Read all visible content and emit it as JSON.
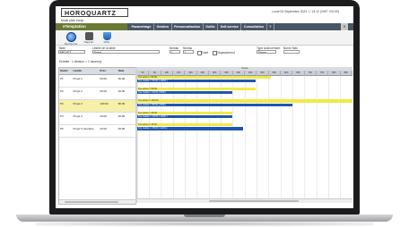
{
  "app": {
    "logo": "HOROQUARTZ",
    "datetime": "Lundi 04 Septembre 2023 ⓘ 13:12 (GMT +02:00)",
    "mode": "Mode plein écran",
    "module": "eTemptation",
    "nav": [
      "Paramétrage",
      "Gestion",
      "Personnalisation",
      "Outils",
      "Self-service",
      "Consultation",
      "?"
    ],
    "close": "✕"
  },
  "toolbar": [
    {
      "label": "Recherche",
      "icon": "search-icon"
    },
    {
      "label": "Rapport",
      "icon": "report-icon"
    },
    {
      "label": "Filtre",
      "icon": "filter-icon"
    }
  ],
  "filters": {
    "table_label": "Table",
    "table_value": "PROJET",
    "libelle_label": "Libellé de la table",
    "libelle_value": "Projet",
    "niveau_label": "Niveau",
    "niveau_value": "1",
    "niveau2_label": "Niveau",
    "niveau2_value": "1",
    "ecart_label": "Ecart",
    "depassement_label": "Dépassement",
    "type_label": "Type Avancement",
    "type_value": "Temps",
    "borne_label": "Borne Max"
  },
  "scale": "Echelle : 1 division = 1 heure(s)",
  "left_grid": {
    "headers": [
      "Statut",
      "Libellé",
      "Prév.",
      "Réal."
    ],
    "rows": [
      {
        "statut": "P1",
        "lib": "Projet 1",
        "prev": "50:00",
        "real": "50:00",
        "sel": false
      },
      {
        "statut": "P2",
        "lib": "Projet 2",
        "prev": "50:00",
        "real": "40:00",
        "sel": false
      },
      {
        "statut": "P3",
        "lib": "Projet 3",
        "prev": "100:00",
        "real": "80:00",
        "sel": true
      },
      {
        "statut": "P4",
        "lib": "Projet 4",
        "prev": "40:00",
        "real": "40:00",
        "sel": false
      },
      {
        "statut": "P5",
        "lib": "Projet 5 (Sociéte)",
        "prev": "40:00",
        "real": "45:00",
        "sel": false
      }
    ]
  },
  "gantt": {
    "title": "Durée",
    "columns": [
      "0h",
      "5h",
      "10h",
      "15h",
      "20h",
      "25h",
      "30h",
      "35h",
      "40h",
      "45h",
      "50h",
      "55h",
      "60h",
      "65h",
      "70h",
      "75h",
      "80h",
      "85h"
    ],
    "bars": [
      {
        "prev_label": "Tps prévu = 50:00",
        "prev_frac": 0.62,
        "real_label": "Tps réalisé = 50:00 ( 100% )",
        "real_frac": 0.55
      },
      {
        "prev_label": "Tps prévu = 50:00",
        "prev_frac": 0.55,
        "real_label": "Tps réalisé = 40:00 ( 80% )",
        "real_frac": 0.44
      },
      {
        "prev_label": "Tps prévu = 100:00",
        "prev_frac": 1.0,
        "real_label": "Tps réalisé = 80:00 ( 80% )",
        "real_frac": 0.72
      },
      {
        "prev_label": "Tps prévu = 40:00",
        "prev_frac": 0.44,
        "real_label": "Tps réalisé = 40:00 ( 100% )",
        "real_frac": 0.44
      },
      {
        "prev_label": "Tps prévu = 40:00",
        "prev_frac": 0.44,
        "real_label": "Tps réalisé = 45:00 ( 112% )",
        "real_frac": 0.49
      }
    ]
  }
}
